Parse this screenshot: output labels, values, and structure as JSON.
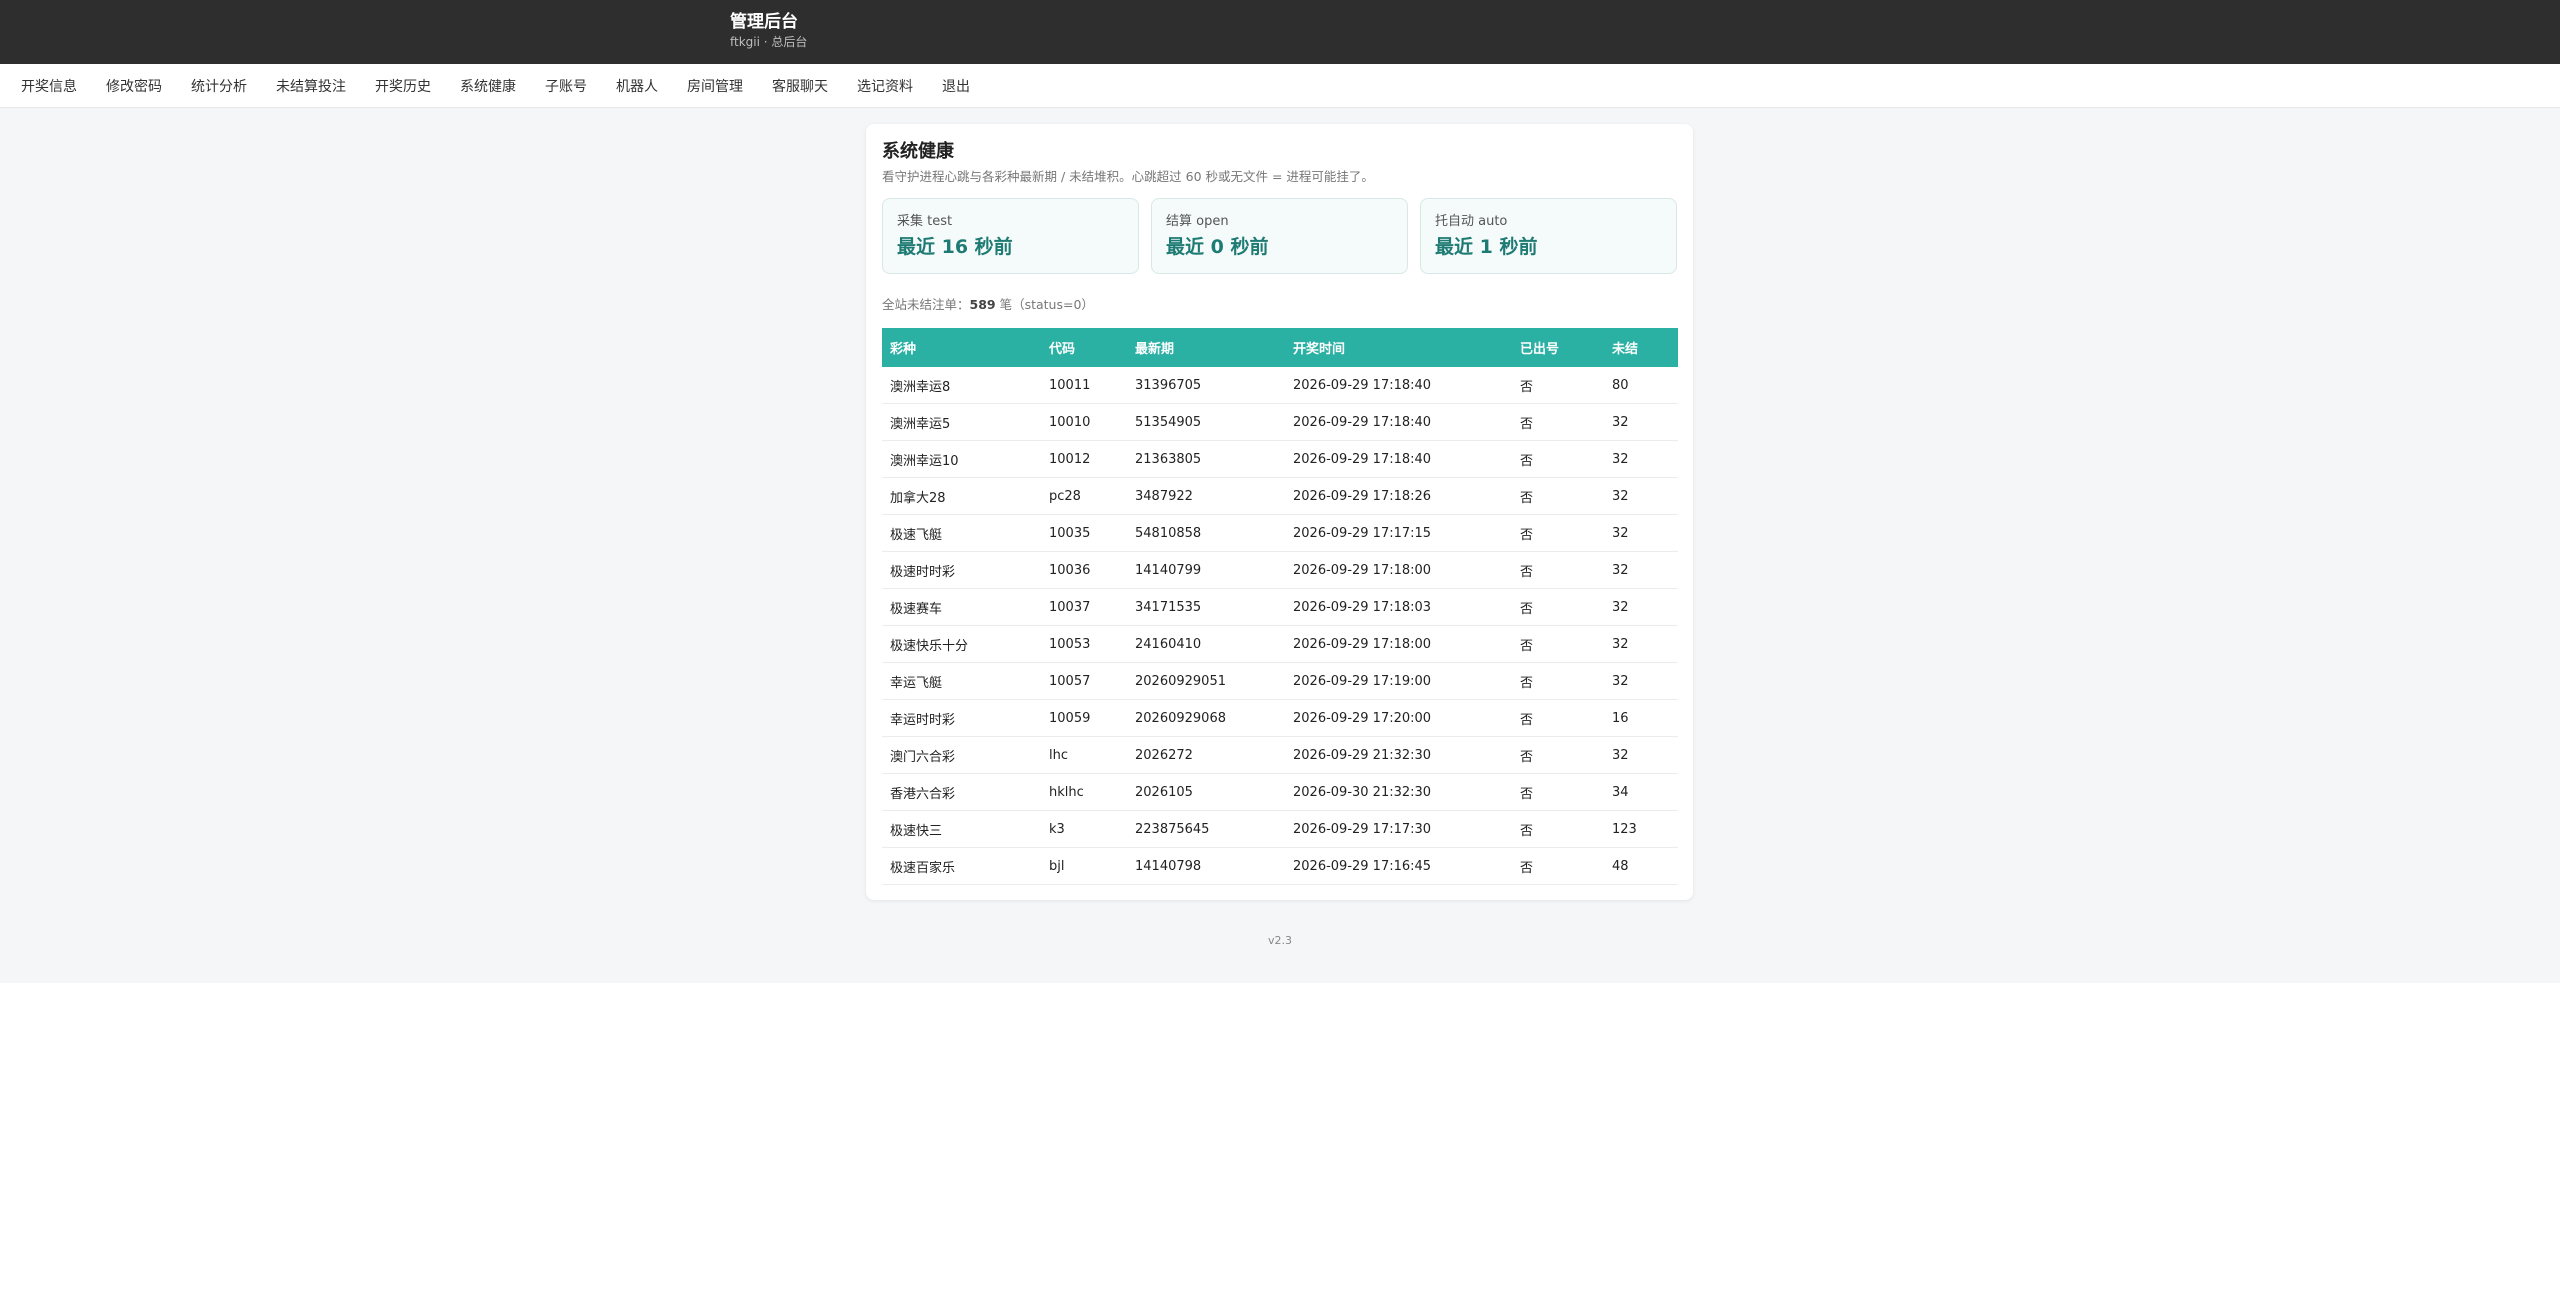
{
  "header": {
    "title": "管理后台",
    "subtitle": "ftkgii · 总后台"
  },
  "nav": {
    "items": [
      {
        "label": "开奖信息"
      },
      {
        "label": "修改密码"
      },
      {
        "label": "统计分析"
      },
      {
        "label": "未结算投注"
      },
      {
        "label": "开奖历史"
      },
      {
        "label": "系统健康"
      },
      {
        "label": "子账号"
      },
      {
        "label": "机器人"
      },
      {
        "label": "房间管理"
      },
      {
        "label": "客服聊天"
      },
      {
        "label": "选记资料"
      },
      {
        "label": "退出"
      }
    ]
  },
  "health": {
    "title": "系统健康",
    "description": "看守护进程心跳与各彩种最新期 / 未结堆积。心跳超过 60 秒或无文件 = 进程可能挂了。",
    "stats": [
      {
        "label": "采集 test",
        "value": "最近 16 秒前"
      },
      {
        "label": "结算 open",
        "value": "最近 0 秒前"
      },
      {
        "label": "托自动 auto",
        "value": "最近 1 秒前"
      }
    ],
    "summary": {
      "prefix": "全站未结注单：",
      "count": "589",
      "suffix": " 笔（status=0）"
    }
  },
  "table": {
    "headers": [
      "彩种",
      "代码",
      "最新期",
      "开奖时间",
      "已出号",
      "未结"
    ],
    "rows": [
      [
        "澳洲幸运8",
        "10011",
        "31396705",
        "2026-09-29 17:18:40",
        "否",
        "80"
      ],
      [
        "澳洲幸运5",
        "10010",
        "51354905",
        "2026-09-29 17:18:40",
        "否",
        "32"
      ],
      [
        "澳洲幸运10",
        "10012",
        "21363805",
        "2026-09-29 17:18:40",
        "否",
        "32"
      ],
      [
        "加拿大28",
        "pc28",
        "3487922",
        "2026-09-29 17:18:26",
        "否",
        "32"
      ],
      [
        "极速飞艇",
        "10035",
        "54810858",
        "2026-09-29 17:17:15",
        "否",
        "32"
      ],
      [
        "极速时时彩",
        "10036",
        "14140799",
        "2026-09-29 17:18:00",
        "否",
        "32"
      ],
      [
        "极速赛车",
        "10037",
        "34171535",
        "2026-09-29 17:18:03",
        "否",
        "32"
      ],
      [
        "极速快乐十分",
        "10053",
        "24160410",
        "2026-09-29 17:18:00",
        "否",
        "32"
      ],
      [
        "幸运飞艇",
        "10057",
        "20260929051",
        "2026-09-29 17:19:00",
        "否",
        "32"
      ],
      [
        "幸运时时彩",
        "10059",
        "20260929068",
        "2026-09-29 17:20:00",
        "否",
        "16"
      ],
      [
        "澳门六合彩",
        "lhc",
        "2026272",
        "2026-09-29 21:32:30",
        "否",
        "32"
      ],
      [
        "香港六合彩",
        "hklhc",
        "2026105",
        "2026-09-30 21:32:30",
        "否",
        "34"
      ],
      [
        "极速快三",
        "k3",
        "223875645",
        "2026-09-29 17:17:30",
        "否",
        "123"
      ],
      [
        "极速百家乐",
        "bjl",
        "14140798",
        "2026-09-29 17:16:45",
        "否",
        "48"
      ]
    ]
  },
  "footer": {
    "version": "v2.3"
  }
}
